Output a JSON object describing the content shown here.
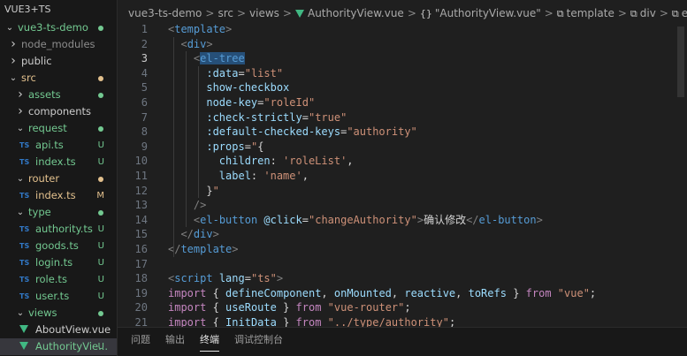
{
  "explorer": {
    "root_label": "VUE3+TS",
    "items": [
      {
        "label": "vue3-ts-demo",
        "kind": "folder-open",
        "depth": 0,
        "status": "",
        "dot": "#73c991"
      },
      {
        "label": "node_modules",
        "kind": "folder-closed",
        "depth": 1,
        "status": "",
        "dot": "",
        "dim": true
      },
      {
        "label": "public",
        "kind": "folder-closed",
        "depth": 1,
        "status": "",
        "dot": ""
      },
      {
        "label": "src",
        "kind": "folder-open",
        "depth": 1,
        "status": "",
        "dot": "#e2c08d"
      },
      {
        "label": "assets",
        "kind": "folder-closed",
        "depth": 2,
        "status": "",
        "dot": "#73c991"
      },
      {
        "label": "components",
        "kind": "folder-closed",
        "depth": 2,
        "status": "",
        "dot": ""
      },
      {
        "label": "request",
        "kind": "folder-open",
        "depth": 2,
        "status": "",
        "dot": "#73c991"
      },
      {
        "label": "api.ts",
        "kind": "ts",
        "depth": 3,
        "status": "U",
        "dot": ""
      },
      {
        "label": "index.ts",
        "kind": "ts",
        "depth": 3,
        "status": "U",
        "dot": ""
      },
      {
        "label": "router",
        "kind": "folder-open",
        "depth": 2,
        "status": "",
        "dot": "#e2c08d"
      },
      {
        "label": "index.ts",
        "kind": "ts",
        "depth": 3,
        "status": "M",
        "dot": ""
      },
      {
        "label": "type",
        "kind": "folder-open",
        "depth": 2,
        "status": "",
        "dot": "#73c991"
      },
      {
        "label": "authority.ts",
        "kind": "ts",
        "depth": 3,
        "status": "U",
        "dot": ""
      },
      {
        "label": "goods.ts",
        "kind": "ts",
        "depth": 3,
        "status": "U",
        "dot": ""
      },
      {
        "label": "login.ts",
        "kind": "ts",
        "depth": 3,
        "status": "U",
        "dot": ""
      },
      {
        "label": "role.ts",
        "kind": "ts",
        "depth": 3,
        "status": "U",
        "dot": ""
      },
      {
        "label": "user.ts",
        "kind": "ts",
        "depth": 3,
        "status": "U",
        "dot": ""
      },
      {
        "label": "views",
        "kind": "folder-open",
        "depth": 2,
        "status": "",
        "dot": "#73c991"
      },
      {
        "label": "AboutView.vue",
        "kind": "vue",
        "depth": 3,
        "status": "",
        "dot": ""
      },
      {
        "label": "AuthorityVie...",
        "kind": "vue",
        "depth": 3,
        "status": "U",
        "dot": "",
        "selected": true
      }
    ]
  },
  "breadcrumb": {
    "project": "vue3-ts-demo",
    "src": "src",
    "views": "views",
    "file": "AuthorityView.vue",
    "component": "\"AuthorityView.vue\"",
    "template": "template",
    "div": "div",
    "eltree": "el-tree"
  },
  "editor": {
    "active_line": 3,
    "lines": [
      {
        "n": "1",
        "segs": [
          [
            "tag-punct",
            "<"
          ],
          [
            "tag",
            "template"
          ],
          [
            "tag-punct",
            ">"
          ]
        ]
      },
      {
        "n": "2",
        "segs": [
          [
            "plain",
            "  "
          ],
          [
            "tag-punct",
            "<"
          ],
          [
            "tag",
            "div"
          ],
          [
            "tag-punct",
            ">"
          ]
        ]
      },
      {
        "n": "3",
        "segs": [
          [
            "plain",
            "    "
          ],
          [
            "tag-punct",
            "<"
          ],
          [
            "tag sel-hl",
            "el-tree"
          ]
        ]
      },
      {
        "n": "4",
        "segs": [
          [
            "plain",
            "      "
          ],
          [
            "attr",
            ":data"
          ],
          [
            "plain",
            "="
          ],
          [
            "str",
            "\"list\""
          ]
        ]
      },
      {
        "n": "5",
        "segs": [
          [
            "plain",
            "      "
          ],
          [
            "attr",
            "show-checkbox"
          ]
        ]
      },
      {
        "n": "6",
        "segs": [
          [
            "plain",
            "      "
          ],
          [
            "attr",
            "node-key"
          ],
          [
            "plain",
            "="
          ],
          [
            "str",
            "\"roleId\""
          ]
        ]
      },
      {
        "n": "7",
        "segs": [
          [
            "plain",
            "      "
          ],
          [
            "attr",
            ":check-strictly"
          ],
          [
            "plain",
            "="
          ],
          [
            "str",
            "\"true\""
          ]
        ]
      },
      {
        "n": "8",
        "segs": [
          [
            "plain",
            "      "
          ],
          [
            "attr",
            ":default-checked-keys"
          ],
          [
            "plain",
            "="
          ],
          [
            "str",
            "\"authority\""
          ]
        ]
      },
      {
        "n": "9",
        "segs": [
          [
            "plain",
            "      "
          ],
          [
            "attr",
            ":props"
          ],
          [
            "plain",
            "="
          ],
          [
            "str",
            "\""
          ],
          [
            "plain",
            "{"
          ]
        ]
      },
      {
        "n": "10",
        "segs": [
          [
            "plain",
            "        "
          ],
          [
            "var",
            "children"
          ],
          [
            "plain",
            ": "
          ],
          [
            "str",
            "'roleList'"
          ],
          [
            "plain",
            ","
          ]
        ]
      },
      {
        "n": "11",
        "segs": [
          [
            "plain",
            "        "
          ],
          [
            "var",
            "label"
          ],
          [
            "plain",
            ": "
          ],
          [
            "str",
            "'name'"
          ],
          [
            "plain",
            ","
          ]
        ]
      },
      {
        "n": "12",
        "segs": [
          [
            "plain",
            "      }"
          ],
          [
            "str",
            "\""
          ]
        ]
      },
      {
        "n": "13",
        "segs": [
          [
            "plain",
            "    "
          ],
          [
            "tag-punct",
            "/>"
          ]
        ]
      },
      {
        "n": "14",
        "segs": [
          [
            "plain",
            "    "
          ],
          [
            "tag-punct",
            "<"
          ],
          [
            "tag",
            "el-button"
          ],
          [
            "plain",
            " "
          ],
          [
            "attr",
            "@click"
          ],
          [
            "plain",
            "="
          ],
          [
            "str",
            "\"changeAuthority\""
          ],
          [
            "tag-punct",
            ">"
          ],
          [
            "plain",
            "确认修改"
          ],
          [
            "tag-punct",
            "</"
          ],
          [
            "tag",
            "el-button"
          ],
          [
            "tag-punct",
            ">"
          ]
        ]
      },
      {
        "n": "15",
        "segs": [
          [
            "plain",
            "  "
          ],
          [
            "tag-punct",
            "</"
          ],
          [
            "tag",
            "div"
          ],
          [
            "tag-punct",
            ">"
          ]
        ]
      },
      {
        "n": "16",
        "segs": [
          [
            "tag-punct",
            "</"
          ],
          [
            "tag",
            "template"
          ],
          [
            "tag-punct",
            ">"
          ]
        ]
      },
      {
        "n": "17",
        "segs": []
      },
      {
        "n": "18",
        "segs": [
          [
            "tag-punct",
            "<"
          ],
          [
            "tag",
            "script"
          ],
          [
            "plain",
            " "
          ],
          [
            "attr",
            "lang"
          ],
          [
            "plain",
            "="
          ],
          [
            "str",
            "\"ts\""
          ],
          [
            "tag-punct",
            ">"
          ]
        ]
      },
      {
        "n": "19",
        "segs": [
          [
            "kw",
            "import"
          ],
          [
            "plain",
            " { "
          ],
          [
            "var",
            "defineComponent"
          ],
          [
            "plain",
            ", "
          ],
          [
            "var",
            "onMounted"
          ],
          [
            "plain",
            ", "
          ],
          [
            "var",
            "reactive"
          ],
          [
            "plain",
            ", "
          ],
          [
            "var",
            "toRefs"
          ],
          [
            "plain",
            " } "
          ],
          [
            "kw",
            "from"
          ],
          [
            "plain",
            " "
          ],
          [
            "str",
            "\"vue\""
          ],
          [
            "plain",
            ";"
          ]
        ]
      },
      {
        "n": "20",
        "segs": [
          [
            "kw",
            "import"
          ],
          [
            "plain",
            " { "
          ],
          [
            "var",
            "useRoute"
          ],
          [
            "plain",
            " } "
          ],
          [
            "kw",
            "from"
          ],
          [
            "plain",
            " "
          ],
          [
            "str",
            "\"vue-router\""
          ],
          [
            "plain",
            ";"
          ]
        ]
      },
      {
        "n": "21",
        "segs": [
          [
            "kw",
            "import"
          ],
          [
            "plain",
            " { "
          ],
          [
            "var",
            "InitData"
          ],
          [
            "plain",
            " } "
          ],
          [
            "kw",
            "from"
          ],
          [
            "plain",
            " "
          ],
          [
            "str",
            "\"../type/authority\""
          ],
          [
            "plain",
            ";"
          ]
        ]
      }
    ]
  },
  "panel": {
    "tabs": [
      {
        "label": "问题",
        "active": false
      },
      {
        "label": "输出",
        "active": false
      },
      {
        "label": "终端",
        "active": true
      },
      {
        "label": "调试控制台",
        "active": false
      }
    ]
  },
  "colors": {
    "untracked": "#73c991",
    "modified": "#e2c08d",
    "ts_badge": "#3178c6",
    "vue": "#41b883"
  }
}
